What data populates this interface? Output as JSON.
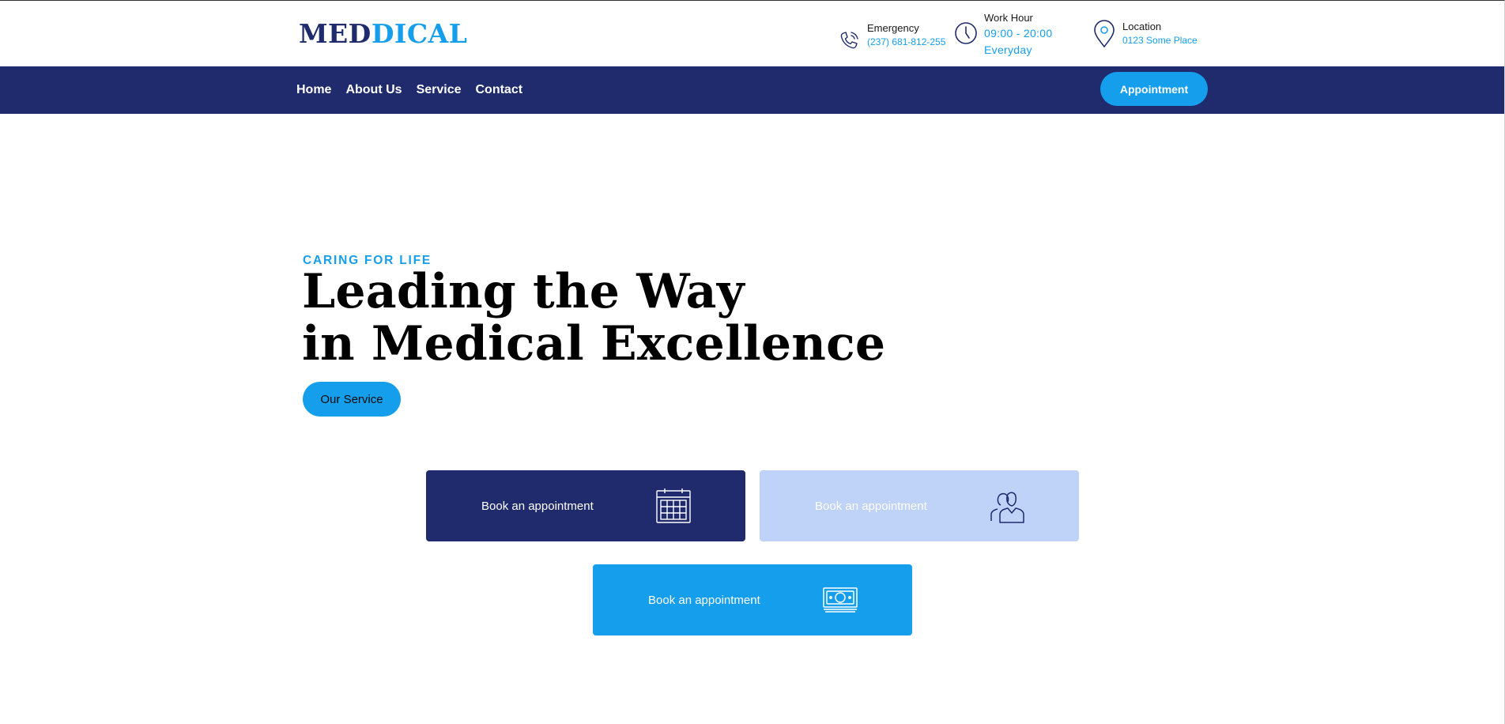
{
  "brand": {
    "logo_part1": "MED",
    "logo_part2": "DICAL",
    "primary_color": "#1f2b6c",
    "accent_color": "#159eec",
    "light_color": "#bfd2f8"
  },
  "header": {
    "emergency": {
      "label": "Emergency",
      "value": "(237) 681-812-255",
      "icon": "phone-icon"
    },
    "work_hour": {
      "label": "Work Hour",
      "value_line1": "09:00 - 20:00",
      "value_line2": "Everyday",
      "icon": "clock-icon"
    },
    "location": {
      "label": "Location",
      "value": "0123 Some Place",
      "icon": "location-pin-icon"
    }
  },
  "nav": {
    "items": [
      {
        "label": "Home"
      },
      {
        "label": "About Us"
      },
      {
        "label": "Service"
      },
      {
        "label": "Contact"
      }
    ],
    "appointment_button": "Appointment"
  },
  "hero": {
    "eyebrow": "CARING FOR LIFE",
    "headline_line1": "Leading the Way",
    "headline_line2": "in Medical Excellence",
    "cta": "Our Service"
  },
  "cards": [
    {
      "label": "Book an appointment",
      "icon": "calendar-icon"
    },
    {
      "label": "Book an appointment",
      "icon": "people-icon"
    },
    {
      "label": "Book an appointment",
      "icon": "money-icon"
    }
  ]
}
